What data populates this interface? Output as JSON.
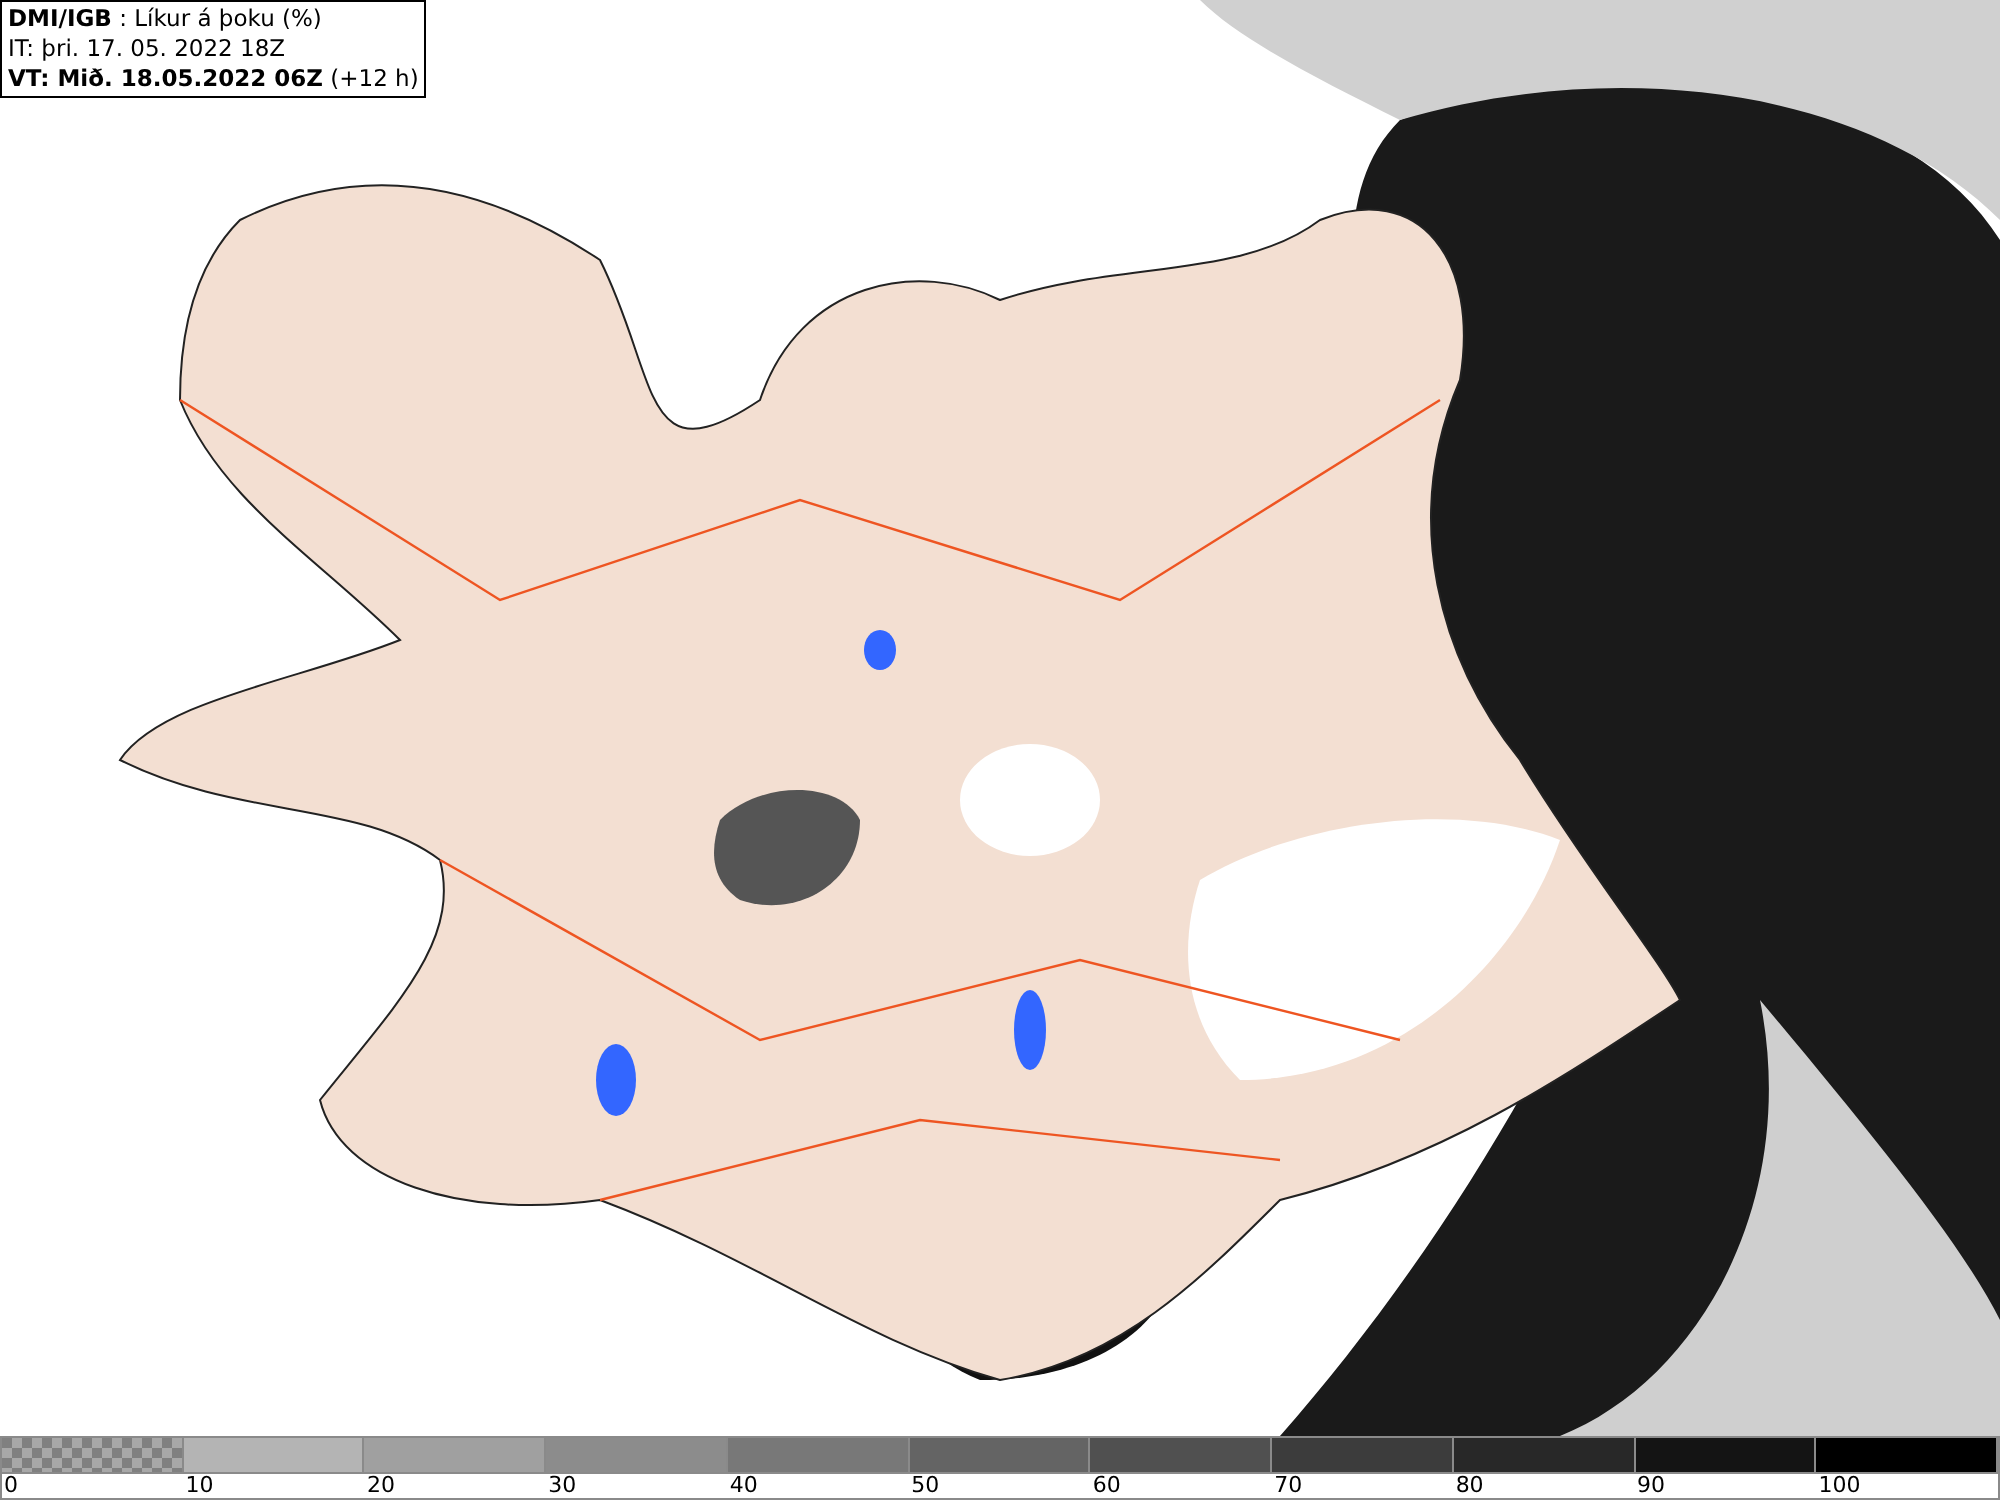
{
  "header": {
    "lines": [
      "**DMI/IGB** : Líkur á þoku (%)",
      "IT: þri. 17. 05. 2022 18Z",
      "**VT: Mið. 18.05.2022 06Z** (+12 h)"
    ]
  },
  "legend": {
    "segments": [
      {
        "kind": "checker",
        "color": "#808080",
        "label": "0"
      },
      {
        "kind": "solid",
        "color": "#b4b4b4",
        "label": "10"
      },
      {
        "kind": "solid",
        "color": "#a0a0a0",
        "label": "20"
      },
      {
        "kind": "solid",
        "color": "#8c8c8c",
        "label": "30"
      },
      {
        "kind": "solid",
        "color": "#787878",
        "label": "40"
      },
      {
        "kind": "solid",
        "color": "#646464",
        "label": "50"
      },
      {
        "kind": "solid",
        "color": "#505050",
        "label": "60"
      },
      {
        "kind": "solid",
        "color": "#3c3c3c",
        "label": "70"
      },
      {
        "kind": "solid",
        "color": "#282828",
        "label": "80"
      },
      {
        "kind": "solid",
        "color": "#141414",
        "label": "90"
      },
      {
        "kind": "solid",
        "color": "#000000",
        "label": "100"
      }
    ]
  }
}
